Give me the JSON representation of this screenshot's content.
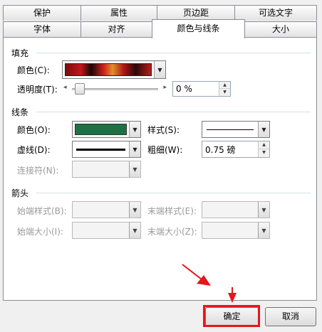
{
  "tabs_row1": [
    {
      "label": "保护"
    },
    {
      "label": "属性"
    },
    {
      "label": "页边距"
    },
    {
      "label": "可选文字"
    }
  ],
  "tabs_row2": [
    {
      "label": "字体"
    },
    {
      "label": "对齐"
    },
    {
      "label": "颜色与线条",
      "active": true
    },
    {
      "label": "大小"
    }
  ],
  "fill": {
    "section_title": "填充",
    "color_label": "颜色(C):",
    "transparency_label": "透明度(T):",
    "transparency_value": "0 %",
    "transparency_level": 0
  },
  "line": {
    "section_title": "线条",
    "color_label": "颜色(O):",
    "color_value": "#1e7145",
    "style_label": "样式(S):",
    "dash_label": "虚线(D):",
    "weight_label": "粗细(W):",
    "weight_value": "0.75 磅",
    "connector_label": "连接符(N):"
  },
  "arrows": {
    "section_title": "箭头",
    "begin_style_label": "始端样式(B):",
    "end_style_label": "末端样式(E):",
    "begin_size_label": "始端大小(I):",
    "end_size_label": "末端大小(Z):"
  },
  "buttons": {
    "ok": "确定",
    "cancel": "取消"
  },
  "colors": {
    "highlight": "#e8151b",
    "annotation_arrow": "#e8151b"
  }
}
